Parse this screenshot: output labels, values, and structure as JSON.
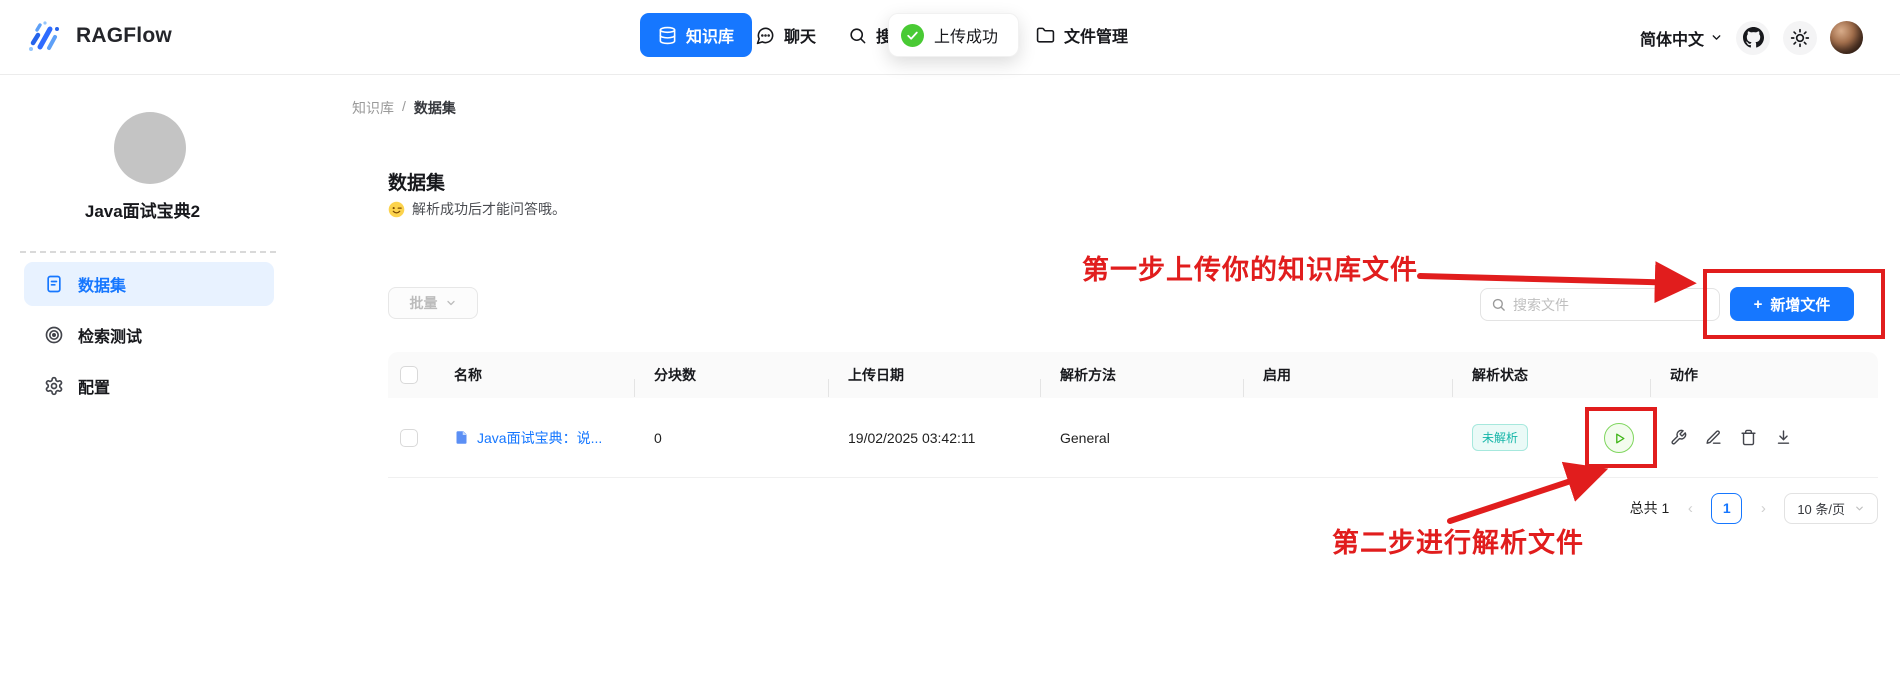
{
  "header": {
    "brand": "RAGFlow",
    "nav": {
      "knowledge": "知识库",
      "chat": "聊天",
      "search": "搜索",
      "files": "文件管理"
    },
    "toast": "上传成功",
    "language": "简体中文"
  },
  "sidebar": {
    "kb_name": "Java面试宝典2",
    "items": [
      {
        "label": "数据集",
        "active": true
      },
      {
        "label": "检索测试",
        "active": false
      },
      {
        "label": "配置",
        "active": false
      }
    ]
  },
  "breadcrumb": {
    "root": "知识库",
    "separator": "/",
    "current": "数据集"
  },
  "content": {
    "title": "数据集",
    "subtitle": "解析成功后才能问答哦。",
    "bulk_label": "批量",
    "search_placeholder": "搜索文件",
    "add_label": "新增文件",
    "add_plus": "+"
  },
  "annotations": {
    "step1": "第一步上传你的知识库文件",
    "step2": "第二步进行解析文件",
    "color": "#e11d1d"
  },
  "table": {
    "columns": [
      "名称",
      "分块数",
      "上传日期",
      "解析方法",
      "启用",
      "解析状态",
      "动作"
    ],
    "rows": [
      {
        "name": "Java面试宝典：说...",
        "chunks": "0",
        "date": "19/02/2025 03:42:11",
        "method": "General",
        "enabled": true,
        "status": "未解析"
      }
    ]
  },
  "pagination": {
    "total": "总共 1",
    "prev": "‹",
    "page": "1",
    "next": "›",
    "page_size": "10 条/页"
  },
  "icons": [
    "ragflow-logo",
    "database-icon",
    "chat-bubble-icon",
    "search-icon",
    "check-circle-icon",
    "folder-icon",
    "chevron-down-icon",
    "github-icon",
    "sun-icon",
    "avatar",
    "dataset-doc-icon",
    "bullseye-icon",
    "gear-icon",
    "smiley-icon",
    "plus-icon",
    "file-icon",
    "toggle",
    "play-icon",
    "wrench-icon",
    "edit-icon",
    "trash-icon",
    "download-icon"
  ],
  "colors": {
    "primary": "#1677ff",
    "annotation_red": "#e11d1d",
    "badge_teal": "#14b5a8",
    "play_green": "#52c41a",
    "toast_green": "#49ca34"
  }
}
